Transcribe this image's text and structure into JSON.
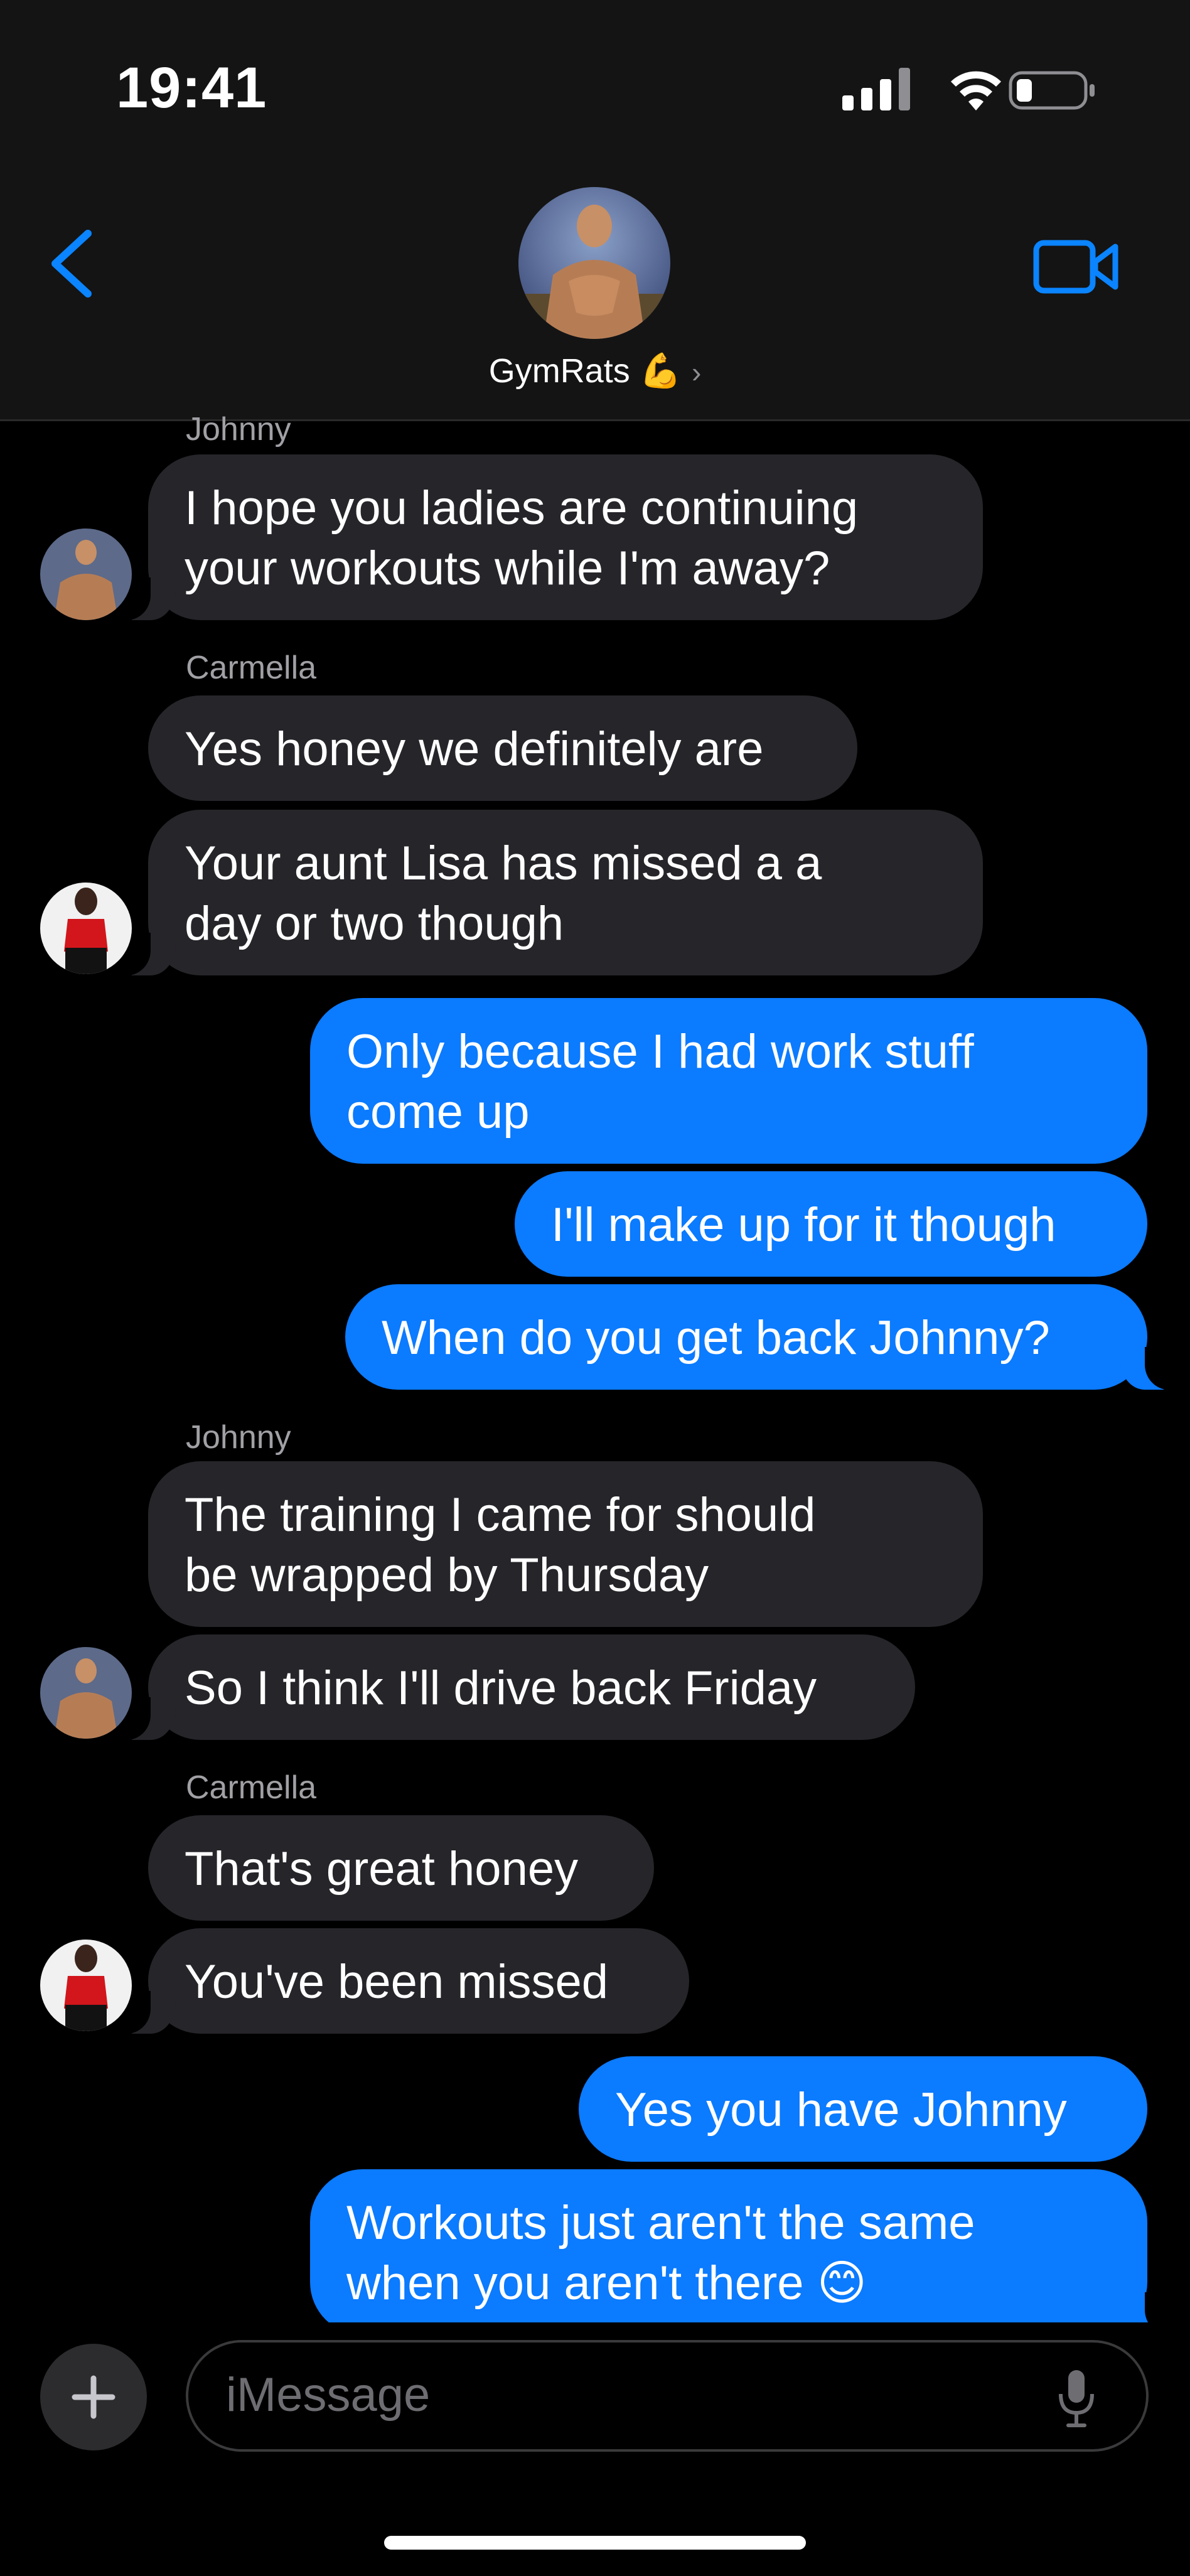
{
  "status_bar": {
    "time": "19:41"
  },
  "header": {
    "group_name": "GymRats 💪",
    "chevron": "›"
  },
  "messages": [
    {
      "sender": "Johnny"
    },
    {
      "text": "I hope you ladies are continuing\nyour workouts while I'm away?"
    },
    {
      "sender": "Carmella"
    },
    {
      "text": "Yes honey we definitely are"
    },
    {
      "text": "Your aunt Lisa has missed a a\nday or two though"
    },
    {
      "text": "Only because I had work stuff\ncome up"
    },
    {
      "text": "I'll make up for it though"
    },
    {
      "text": "When do you get back Johnny?"
    },
    {
      "sender": "Johnny"
    },
    {
      "text": "The training I came for should\nbe wrapped by Thursday"
    },
    {
      "text": "So I think I'll drive back Friday"
    },
    {
      "sender": "Carmella"
    },
    {
      "text": "That's great honey"
    },
    {
      "text": "You've been missed"
    },
    {
      "text": "Yes you have Johnny"
    },
    {
      "text": "Workouts just aren't the same\nwhen you aren't there 😊"
    }
  ],
  "composer": {
    "placeholder": "iMessage",
    "plus": "+"
  },
  "colors": {
    "outgoing": "#0b7bff",
    "incoming": "#26252a",
    "accent": "#0a84ff"
  }
}
